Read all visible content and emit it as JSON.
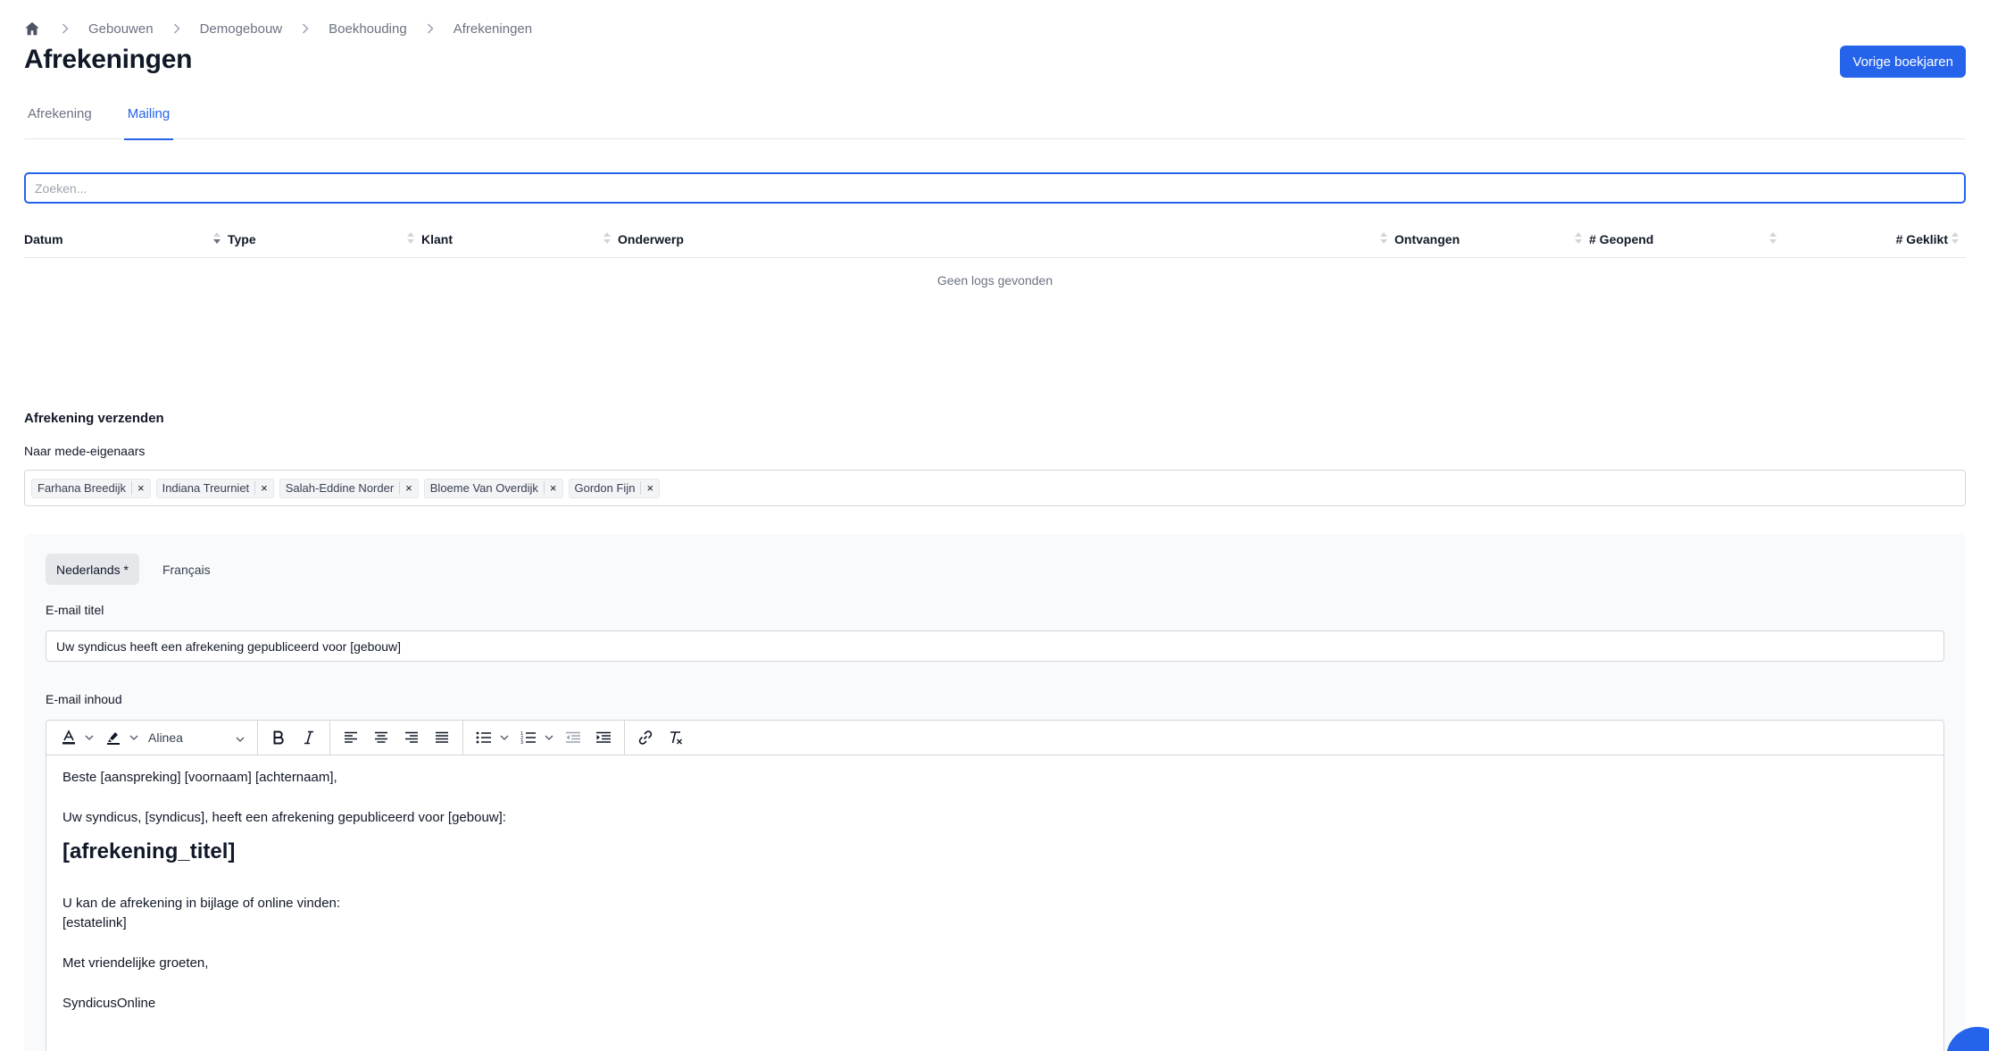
{
  "breadcrumb": [
    "Gebouwen",
    "Demogebouw",
    "Boekhouding",
    "Afrekeningen"
  ],
  "page_title": "Afrekeningen",
  "header": {
    "primary_button": "Vorige boekjaren"
  },
  "tabs": [
    {
      "label": "Afrekening",
      "active": false
    },
    {
      "label": "Mailing",
      "active": true
    }
  ],
  "search": {
    "placeholder": "Zoeken...",
    "value": ""
  },
  "table": {
    "columns": [
      "Datum",
      "Type",
      "Klant",
      "Onderwerp",
      "Ontvangen",
      "# Geopend",
      "# Geklikt"
    ],
    "sorted_column": "Datum",
    "sort_direction": "desc",
    "empty_message": "Geen logs gevonden"
  },
  "send_section": {
    "title": "Afrekening verzenden",
    "recipients_label": "Naar mede-eigenaars",
    "recipients": [
      "Farhana Breedijk",
      "Indiana Treurniet",
      "Salah-Eddine Norder",
      "Bloeme Van Overdijk",
      "Gordon Fijn"
    ],
    "remove_glyph": "×"
  },
  "languages": [
    {
      "label": "Nederlands *",
      "active": true
    },
    {
      "label": "Français",
      "active": false
    }
  ],
  "email": {
    "title_label": "E-mail titel",
    "title_value": "Uw syndicus heeft een afrekening gepubliceerd voor [gebouw]",
    "content_label": "E-mail inhoud",
    "format_select": "Alinea",
    "body": {
      "greeting": "Beste [aanspreking] [voornaam] [achternaam],",
      "intro": "Uw syndicus, [syndicus], heeft een afrekening gepubliceerd voor [gebouw]:",
      "heading": "[afrekening_titel]",
      "online_line": "U kan de afrekening in bijlage of online vinden:",
      "link": "[estatelink]",
      "closing": "Met vriendelijke groeten,",
      "signature": "SyndicusOnline"
    }
  },
  "colors": {
    "accent": "#2563eb",
    "text": "#111827",
    "muted": "#6b7280",
    "border": "#d1d5db",
    "panel": "#f9fafb"
  },
  "icons": [
    "home-icon",
    "chevron-right-icon",
    "sort-icon",
    "close-icon",
    "font-color-icon",
    "highlight-icon",
    "chevron-down-icon",
    "bold-icon",
    "italic-icon",
    "align-left-icon",
    "align-center-icon",
    "align-right-icon",
    "align-justify-icon",
    "bullet-list-icon",
    "numbered-list-icon",
    "outdent-icon",
    "indent-icon",
    "link-icon",
    "clear-format-icon",
    "chat-icon"
  ]
}
